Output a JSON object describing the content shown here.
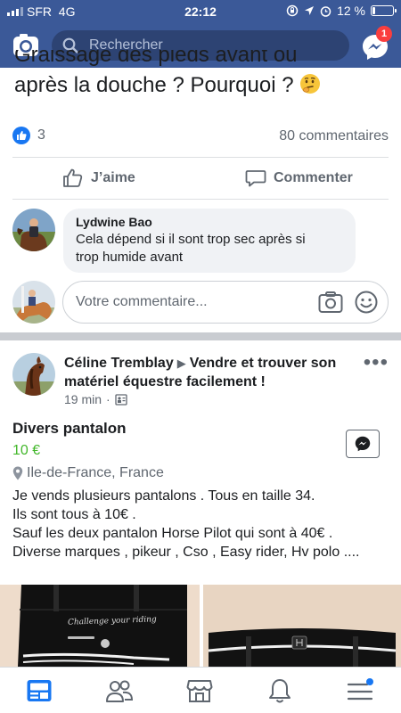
{
  "status_bar": {
    "carrier": "SFR",
    "network": "4G",
    "time": "22:12",
    "battery_text": "12 %",
    "battery_level": 0.12
  },
  "header": {
    "search_placeholder": "Rechercher",
    "messenger_badge": "1",
    "icons": [
      "camera-icon",
      "search-icon",
      "messenger-icon"
    ],
    "brand_color": "#3b5998"
  },
  "post1": {
    "title_line1": "Graissage des pieds avant ou",
    "title_line2": "après la douche ? Pourquoi ?",
    "title_emoji": "thinking-face",
    "like_count": "3",
    "comment_count": "80 commentaires",
    "like_label": "J’aime",
    "comment_label": "Commenter",
    "comment": {
      "author": "Lydwine Bao",
      "text_line1": "Cela dépend si il sont trop sec après si",
      "text_line2": "trop humide avant"
    },
    "comment_placeholder": "Votre commentaire..."
  },
  "post2": {
    "author": "Céline Tremblay",
    "group": "Vendre et trouver son matériel équestre facilement !",
    "time": "19 min",
    "item_title": "Divers pantalon",
    "price": "10 €",
    "location": "Ile-de-France, France",
    "description": [
      "Je vends plusieurs pantalons . Tous en taille 34.",
      "Ils sont tous à 10€ .",
      "Sauf les deux pantalon Horse Pilot qui sont à 40€ .",
      "Diverse marques , pikeur , Cso , Easy rider, Hv polo ...."
    ],
    "photo_text": "Challenge your riding",
    "price_color": "#42b72a"
  },
  "bottom_nav": [
    "news-feed-icon",
    "friends-icon",
    "marketplace-icon",
    "notifications-icon",
    "menu-icon"
  ],
  "accent_color": "#1877f2"
}
